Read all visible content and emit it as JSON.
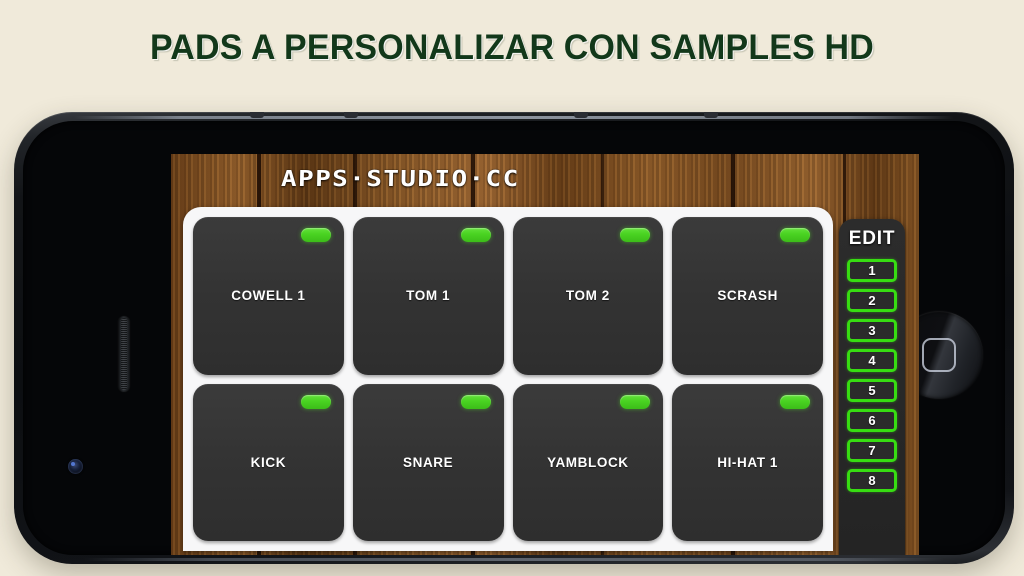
{
  "headline": "PADS A PERSONALIZAR CON SAMPLES HD",
  "colors": {
    "page_background": "#f0eada",
    "headline_text": "#12381a",
    "led_green": "#49d221",
    "edit_border_green": "#37dd12",
    "pad_body": "#333333",
    "pad_frame": "#f7f7f8",
    "wood_base": "#8a5a26"
  },
  "device": {
    "name": "smartphone-mockup",
    "orientation": "landscape",
    "parts": {
      "earpiece": "earpiece-speaker",
      "camera": "front-camera",
      "home": "home-button"
    }
  },
  "app": {
    "logo": "APPS·STUDIO·CC",
    "pads": [
      {
        "id": 1,
        "label": "COWELL 1",
        "led": "on"
      },
      {
        "id": 2,
        "label": "TOM 1",
        "led": "on"
      },
      {
        "id": 3,
        "label": "TOM 2",
        "led": "on"
      },
      {
        "id": 4,
        "label": "SCRASH",
        "led": "on"
      },
      {
        "id": 5,
        "label": "KICK",
        "led": "on"
      },
      {
        "id": 6,
        "label": "SNARE",
        "led": "on"
      },
      {
        "id": 7,
        "label": "YAMBLOCK",
        "led": "on"
      },
      {
        "id": 8,
        "label": "HI-HAT 1",
        "led": "on"
      }
    ],
    "edit_panel": {
      "title": "EDIT",
      "buttons": [
        "1",
        "2",
        "3",
        "4",
        "5",
        "6",
        "7",
        "8"
      ]
    }
  }
}
